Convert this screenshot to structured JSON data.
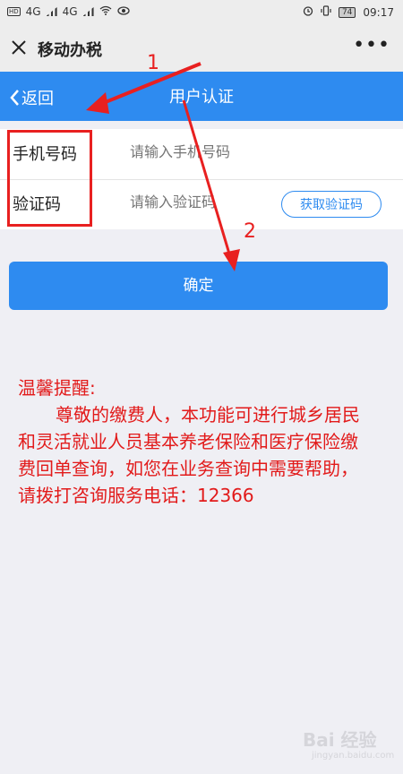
{
  "status_bar": {
    "network_1": "4G",
    "network_2": "4G",
    "battery": "74",
    "time": "09:17"
  },
  "top_bar": {
    "app_title": "移动办税",
    "more": "•••"
  },
  "nav_bar": {
    "back_label": "返回",
    "title": "用户认证"
  },
  "form": {
    "phone_label": "手机号码",
    "phone_placeholder": "请输入手机号码",
    "code_label": "验证码",
    "code_placeholder": "请输入验证码",
    "get_code_label": "获取验证码"
  },
  "confirm_label": "确定",
  "notice": {
    "title": "温馨提醒:",
    "body": "尊敬的缴费人，本功能可进行城乡居民和灵活就业人员基本养老保险和医疗保险缴费回单查询，如您在业务查询中需要帮助，请拨打咨询服务电话：12366"
  },
  "annotations": {
    "marker_1": "1",
    "marker_2": "2",
    "color": "#e82020"
  },
  "watermark": {
    "text": "Bai 经验",
    "sub": "jingyan.baidu.com"
  },
  "colors": {
    "accent": "#2e8bf0",
    "notice_text": "#e21a1a"
  }
}
